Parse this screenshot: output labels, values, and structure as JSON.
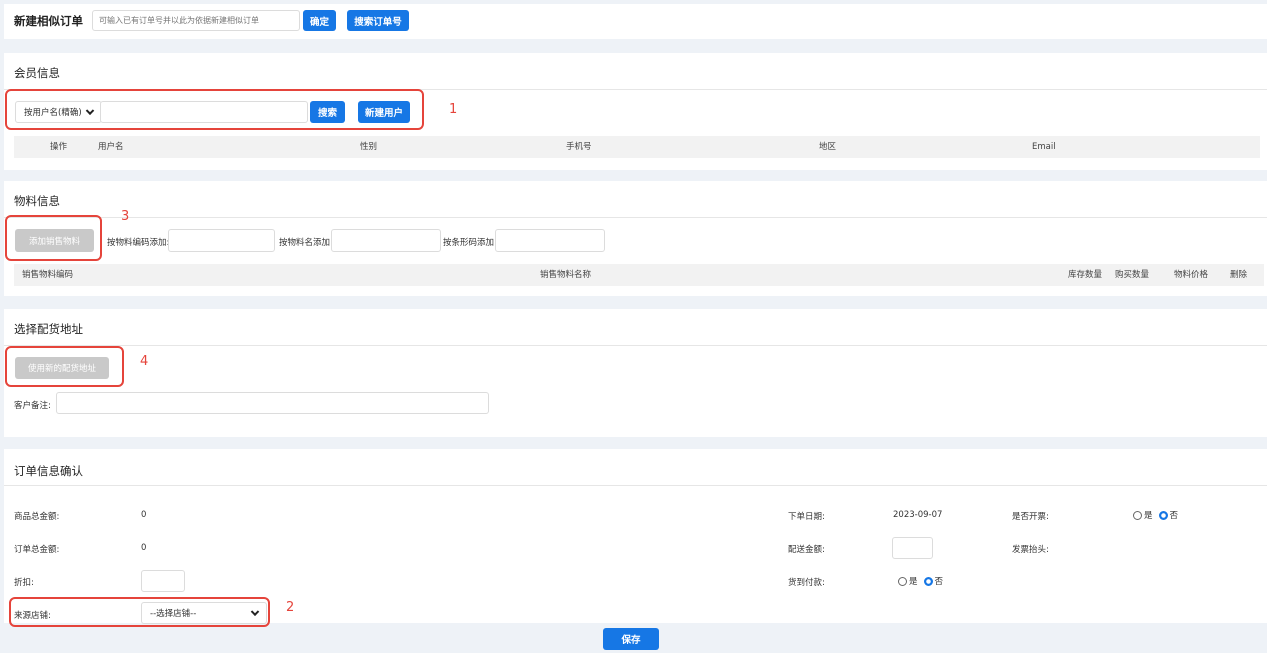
{
  "similar_order": {
    "title": "新建相似订单",
    "placeholder": "可输入已有订单号并以此为依据新建相似订单",
    "confirm_label": "确定",
    "search_order_label": "搜索订单号"
  },
  "member": {
    "title": "会员信息",
    "search_mode": "按用户名(精确)",
    "search_label": "搜索",
    "new_user_label": "新建用户",
    "columns": [
      "操作",
      "用户名",
      "性别",
      "手机号",
      "地区",
      "Email"
    ]
  },
  "material": {
    "title": "物料信息",
    "add_label": "添加销售物料",
    "by_code_label": "按物料编码添加:",
    "by_name_label": "按物料名添加:",
    "by_barcode_label": "按条形码添加:",
    "columns": [
      "销售物料编码",
      "销售物料名称",
      "库存数量",
      "购买数量",
      "物料价格",
      "删除"
    ]
  },
  "address": {
    "title": "选择配货地址",
    "new_address_label": "使用新的配货地址",
    "remark_label": "客户备注:"
  },
  "order": {
    "title": "订单信息确认",
    "goods_total_label": "商品总金额:",
    "goods_total_value": "0",
    "order_total_label": "订单总金额:",
    "order_total_value": "0",
    "discount_label": "折扣:",
    "source_store_label": "来源店铺:",
    "source_store_value": "--选择店铺--",
    "order_date_label": "下单日期:",
    "order_date_value": "2023-09-07",
    "shipping_label": "配送金额:",
    "cod_label": "货到付款:",
    "invoice_label": "是否开票:",
    "invoice_title_label": "发票抬头:",
    "yes": "是",
    "no": "否"
  },
  "save_label": "保存",
  "annotations": [
    "1",
    "2",
    "3",
    "4"
  ],
  "colors": {
    "primary": "#1677e5",
    "annotation": "#e5443b",
    "disabled": "#c9c9c9"
  }
}
